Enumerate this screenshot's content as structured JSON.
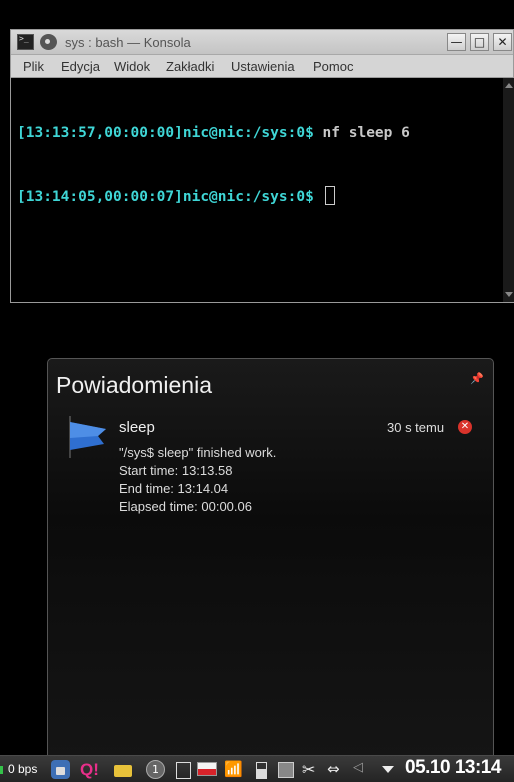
{
  "konsole": {
    "title": "sys : bash — Konsola",
    "controls": {
      "minimize": "—",
      "maximize": "□",
      "close": "✕"
    },
    "menu": [
      "Plik",
      "Edycja",
      "Widok",
      "Zakładki",
      "Ustawienia",
      "Pomoc"
    ],
    "lines": [
      {
        "prompt": "[13:13:57,00:00:00]nic@nic:/sys:0$",
        "command": " nf sleep 6"
      },
      {
        "prompt": "[13:14:05,00:00:07]nic@nic:/sys:0$",
        "command": " "
      }
    ]
  },
  "notifications": {
    "title": "Powiadomienia",
    "pin_icon": "pin-icon",
    "entry": {
      "app": "sleep",
      "age": "30 s temu",
      "close_icon": "close-icon",
      "body": [
        "\"/sys$ sleep\" finished work.",
        "Start time: 13:13.58",
        "End time: 13:14.04",
        "Elapsed time: 00:00.06"
      ]
    }
  },
  "taskbar": {
    "network": "0 bps",
    "desktop_number": "1",
    "q_label": "Q!",
    "clock": "05.10 13:14",
    "icons": [
      "lock-icon",
      "q-icon",
      "folder-icon",
      "desktop-pager-icon",
      "printer-icon",
      "flag-pl-icon",
      "wifi-icon",
      "battery-icon",
      "notes-icon",
      "scissors-icon",
      "usb-icon",
      "volume-icon",
      "expand-tray-icon"
    ]
  },
  "colors": {
    "prompt": "#3fd6d6",
    "close_badge": "#d9332b",
    "flag_red": "#d8232a"
  }
}
